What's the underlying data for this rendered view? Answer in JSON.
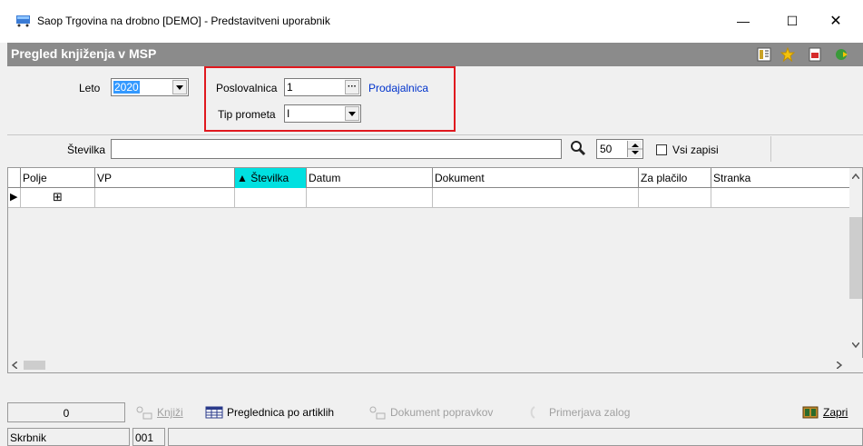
{
  "window": {
    "title": "Saop Trgovina na drobno [DEMO] - Predstavitveni uporabnik",
    "minimize": "—",
    "maximize": "☐",
    "close": "✕"
  },
  "header": {
    "title": "Pregled knjiženja v MSP"
  },
  "filters": {
    "leto_label": "Leto",
    "leto_value": "2020",
    "poslovalnica_label": "Poslovalnica",
    "poslovalnica_value": "1",
    "poslovalnica_name": "Prodajalnica",
    "tip_prometa_label": "Tip prometa",
    "tip_prometa_value": "I",
    "ellipsis": "···"
  },
  "search": {
    "stevilka_label": "Številka",
    "stevilka_value": "",
    "limit_value": "50",
    "vsi_zapisi_label": "Vsi zapisi"
  },
  "grid": {
    "columns": [
      "Polje",
      "VP",
      "▲ Številka",
      "Datum",
      "Dokument",
      "Za plačilo",
      "Stranka"
    ],
    "row_marker": "▶",
    "expand": "⊞"
  },
  "toolbar": {
    "count": "0",
    "knjizi": "Knjiži",
    "preglednica": "Preglednica po artiklih",
    "dokument_popravkov": "Dokument popravkov",
    "primerjava_zalog": "Primerjava zalog",
    "zapri": "Zapri"
  },
  "status": {
    "user": "Skrbnik",
    "code": "001"
  }
}
